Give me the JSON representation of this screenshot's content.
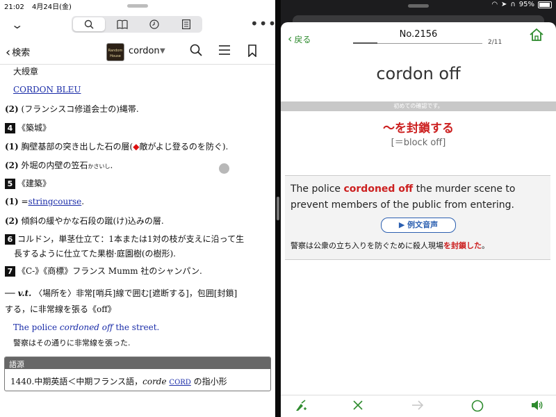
{
  "status": {
    "time": "21:02",
    "date": "4月24日(金)",
    "battery": "95%"
  },
  "left": {
    "back_label": "検索",
    "dict_title": "cordon",
    "book_label": "Random House",
    "lines": {
      "l1": "大綬章",
      "l2": "CORDON BLEU",
      "l3a": "(2)",
      "l3b": " (フランシスコ修道会士の)縄帯.",
      "n4": "4",
      "l4": "《築城》",
      "l5a": "(1)",
      "l5b": " 胸壁基部の突き出した石の層(",
      "l5c": "◆",
      "l5d": "敵がよじ登るのを防ぐ).",
      "l6a": "(2)",
      "l6b": " 外堀の内壁の笠石",
      "l6c": "かさいし",
      "l6d": ".",
      "n7": "5",
      "l7": "《建築》",
      "l8a": "(1)",
      "l8b": " =",
      "l8c": "stringcourse",
      "l8d": ".",
      "l9a": "(2)",
      "l9b": " 傾斜の緩やかな石段の蹴(け)込みの層.",
      "n10": "6",
      "l10": "コルドン，単茎仕立て：1本または1対の枝が支えに沿って生",
      "l11": "長するように仕立てた果樹·庭園樹(の樹形).",
      "n12": "7",
      "l12": "《C-》《商標》フランス Mumm 社のシャンパン.",
      "l13a": "── v.t.",
      "l13b": " 〈場所を〉非常[哨兵]線で囲む[遮断する]，包囲[封鎖]",
      "l14": "する，に非常線を張る《off》",
      "l15a": "The police ",
      "l15b": "cordoned off",
      "l15c": " the street.",
      "l16": "警察はその通りに非常線を張った."
    },
    "etymology": {
      "heading": "語源",
      "text_a": "1440.中期英語＜中期フランス語，",
      "text_b": "corde",
      "text_c": "CORD",
      "text_d": " の指小形"
    }
  },
  "right": {
    "back_label": "戻る",
    "number": "No.2156",
    "page": "2/11",
    "progress": 0.19,
    "headword": "cordon off",
    "first_time_notice": "初めての確認です。",
    "meaning": "〜を封鎖する",
    "synonym": "[＝block off]",
    "example_en_a": "The police ",
    "example_en_b": "cordoned off",
    "example_en_c": " the murder scene to prevent members of the public from entering.",
    "audio_button": "▶ 例文音声",
    "example_jp_a": "警察は公衆の立ち入りを防ぐために殺人現場",
    "example_jp_b": "を封鎖した",
    "example_jp_c": "。"
  },
  "colors": {
    "accent_green": "#2e8b2e",
    "highlight_red": "#cc2020",
    "link_blue": "#1a2ca8"
  }
}
